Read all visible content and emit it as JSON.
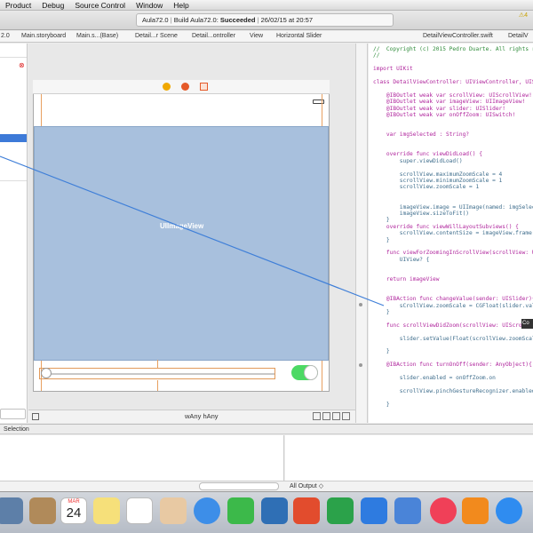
{
  "menubar": {
    "items": [
      "Product",
      "Debug",
      "Source Control",
      "Window",
      "Help"
    ]
  },
  "toolbar": {
    "activity": {
      "project": "Aula72.0",
      "build_prefix": "Build Aula72.0:",
      "status": "Succeeded",
      "timestamp": "26/02/15 at 20:57"
    },
    "warnings": "4"
  },
  "jumpbar": {
    "left": [
      "2.0",
      "Main.storyboard",
      "Main.s...(Base)",
      "Detail...r Scene",
      "Detail...ontroller",
      "View",
      "Horizontal Slider"
    ],
    "right": [
      "DetailViewController.swift",
      "DetailV"
    ]
  },
  "canvas": {
    "image_view_label": "UIImageView",
    "size_class_w": "Any",
    "size_class_h": "Any",
    "size_prefix_w": "w",
    "size_prefix_h": "h"
  },
  "editor": {
    "lines": [
      "//  Copyright (c) 2015 Pedro Duarte. All rights r",
      "//",
      "",
      "import UIKit",
      "",
      "class DetailViewController: UIViewController, UIS",
      "",
      "    @IBOutlet weak var scrollView: UIScrollView!",
      "    @IBOutlet weak var imageView: UIImageView!",
      "    @IBOutlet weak var slider: UISlider!",
      "    @IBOutlet weak var onOffZoom: UISwitch!",
      "",
      "",
      "    var imgSelected : String?",
      "",
      "",
      "    override func viewDidLoad() {",
      "        super.viewDidLoad()",
      "",
      "        scrollView.maximumZoomScale = 4",
      "        scrollView.minimumZoomScale = 1",
      "        scrollView.zoomScale = 1",
      "",
      "",
      "        imageView.image = UIImage(named: imgSelec",
      "        imageView.sizeToFit()",
      "    }",
      "    override func viewWillLayoutSubviews() {",
      "        scrollView.contentSize = imageView.frame.",
      "    }",
      "",
      "    func viewForZoomingInScrollView(scrollView: U",
      "        UIView? {",
      "",
      "",
      "    return imageView",
      "",
      "",
      "    @IBAction func changeValue(sender: UISlider){",
      "        sCrollView.zoomScale = CGFloat(slider.val",
      "    }",
      "",
      "    func scrollViewDidZoom(scrollView: UIScrollV",
      "",
      "        slider.setValue(Float(scrollView.zoomScal",
      "",
      "    }",
      "",
      "    @IBAction func turnOnOff(sender: AnyObject){",
      "",
      "        slider.enabled = onOffZoom.on",
      "",
      "        scrollView.pinchGestureRecognizer.enabled",
      "",
      "    }"
    ],
    "connection_tip": "Co"
  },
  "debug": {
    "left_label": "Selection",
    "output_filter": "All Output",
    "output_arrow": "◇"
  },
  "dock": {
    "calendar_month": "MAR",
    "calendar_day": "24"
  },
  "colors": {
    "accent": "#3d7ad8",
    "image_view": "#a8c0dd",
    "switch_on": "#4cd964",
    "keyword": "#b0269d",
    "comment": "#2f8c3a",
    "connection_line": "#3f7fd8"
  }
}
